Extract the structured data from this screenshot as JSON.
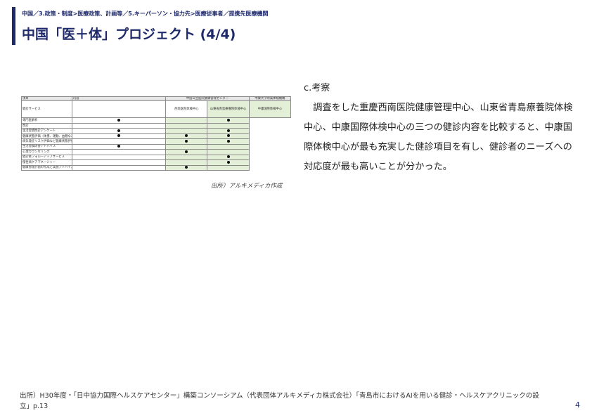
{
  "header": {
    "breadcrumb": "中国／3.政策・制度>医療政策、計画等／5.キーパーソン・協力先>医療従事者／提携先医療機関",
    "title": "中国「医＋体」プロジェクト (4/4)",
    "accent_color": "#1f2a6b"
  },
  "figure": {
    "table": {
      "headers": [
        "項目",
        "内容",
        "中国公立医院健康管理センター",
        "中康大学附属体検機構"
      ],
      "sub_headers": [
        "西南医院体検中心",
        "山東省青島療養院体検中心",
        "中康国際体検中心"
      ],
      "row_group_label": "健診サービス",
      "items": [
        {
          "label": "専門医解析",
          "marks": [
            true,
            false,
            true
          ]
        },
        {
          "label": "問診",
          "marks": [
            false,
            false,
            false
          ]
        },
        {
          "label": "生活習慣問診アンケート",
          "marks": [
            true,
            false,
            true
          ]
        },
        {
          "label": "健康状態評価（体重、運動、血糖などの推移）",
          "marks": [
            true,
            true,
            true
          ]
        },
        {
          "label": "病気発症リスク評価など健康状態評価サービス",
          "marks": [
            false,
            true,
            true
          ]
        },
        {
          "label": "生活習慣改善アドバイス",
          "marks": [
            true,
            false,
            false
          ]
        },
        {
          "label": "心理カウンセリング",
          "marks": [
            false,
            true,
            false
          ]
        },
        {
          "label": "健診後フォローアップサービス",
          "marks": [
            false,
            false,
            true
          ]
        },
        {
          "label": "慢性病ケアマネージャー",
          "marks": [
            false,
            false,
            true
          ]
        },
        {
          "label": "健康管理計画の作成と実施アドバイス",
          "marks": [
            false,
            true,
            false
          ]
        }
      ],
      "highlight_color": "#e3efd6"
    },
    "caption": "出所）アルキメディカ作成"
  },
  "main": {
    "heading": "c.考察",
    "body": "調査をした重慶西南医院健康管理中心、山東省青島療養院体検中心、中康国際体検中心の三つの健診内容を比較すると、中康国際体検中心が最も充実した健診項目を有し、健診者のニーズへの対応度が最も高いことが分かった。"
  },
  "footer": {
    "source": "出所）H30年度・「日中協力国際ヘルスケアセンター」構築コンソーシアム（代表団体アルキメディカ株式会社）「青島市におけるAIを用いる健診・ヘルスケアクリニックの設立」p.13",
    "page_number": "4"
  }
}
